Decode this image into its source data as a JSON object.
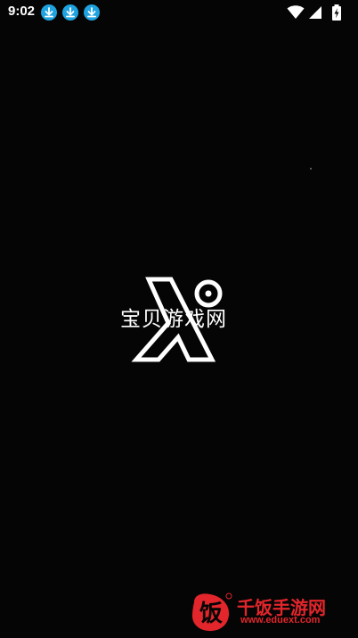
{
  "status_bar": {
    "time": "9:02",
    "notification_icons": [
      "download-icon",
      "download-icon",
      "download-icon"
    ],
    "system_icons": [
      "wifi-icon",
      "signal-icon",
      "battery-charging-icon"
    ],
    "accent_color": "#1fa3e0"
  },
  "splash": {
    "logo_icon": "lambda-logo-icon",
    "overlay_text": "宝贝游戏网"
  },
  "corner_watermark": {
    "badge_glyph": "饭",
    "title": "千饭手游网",
    "url": "www.eduext.com",
    "color": "#e2262b"
  }
}
